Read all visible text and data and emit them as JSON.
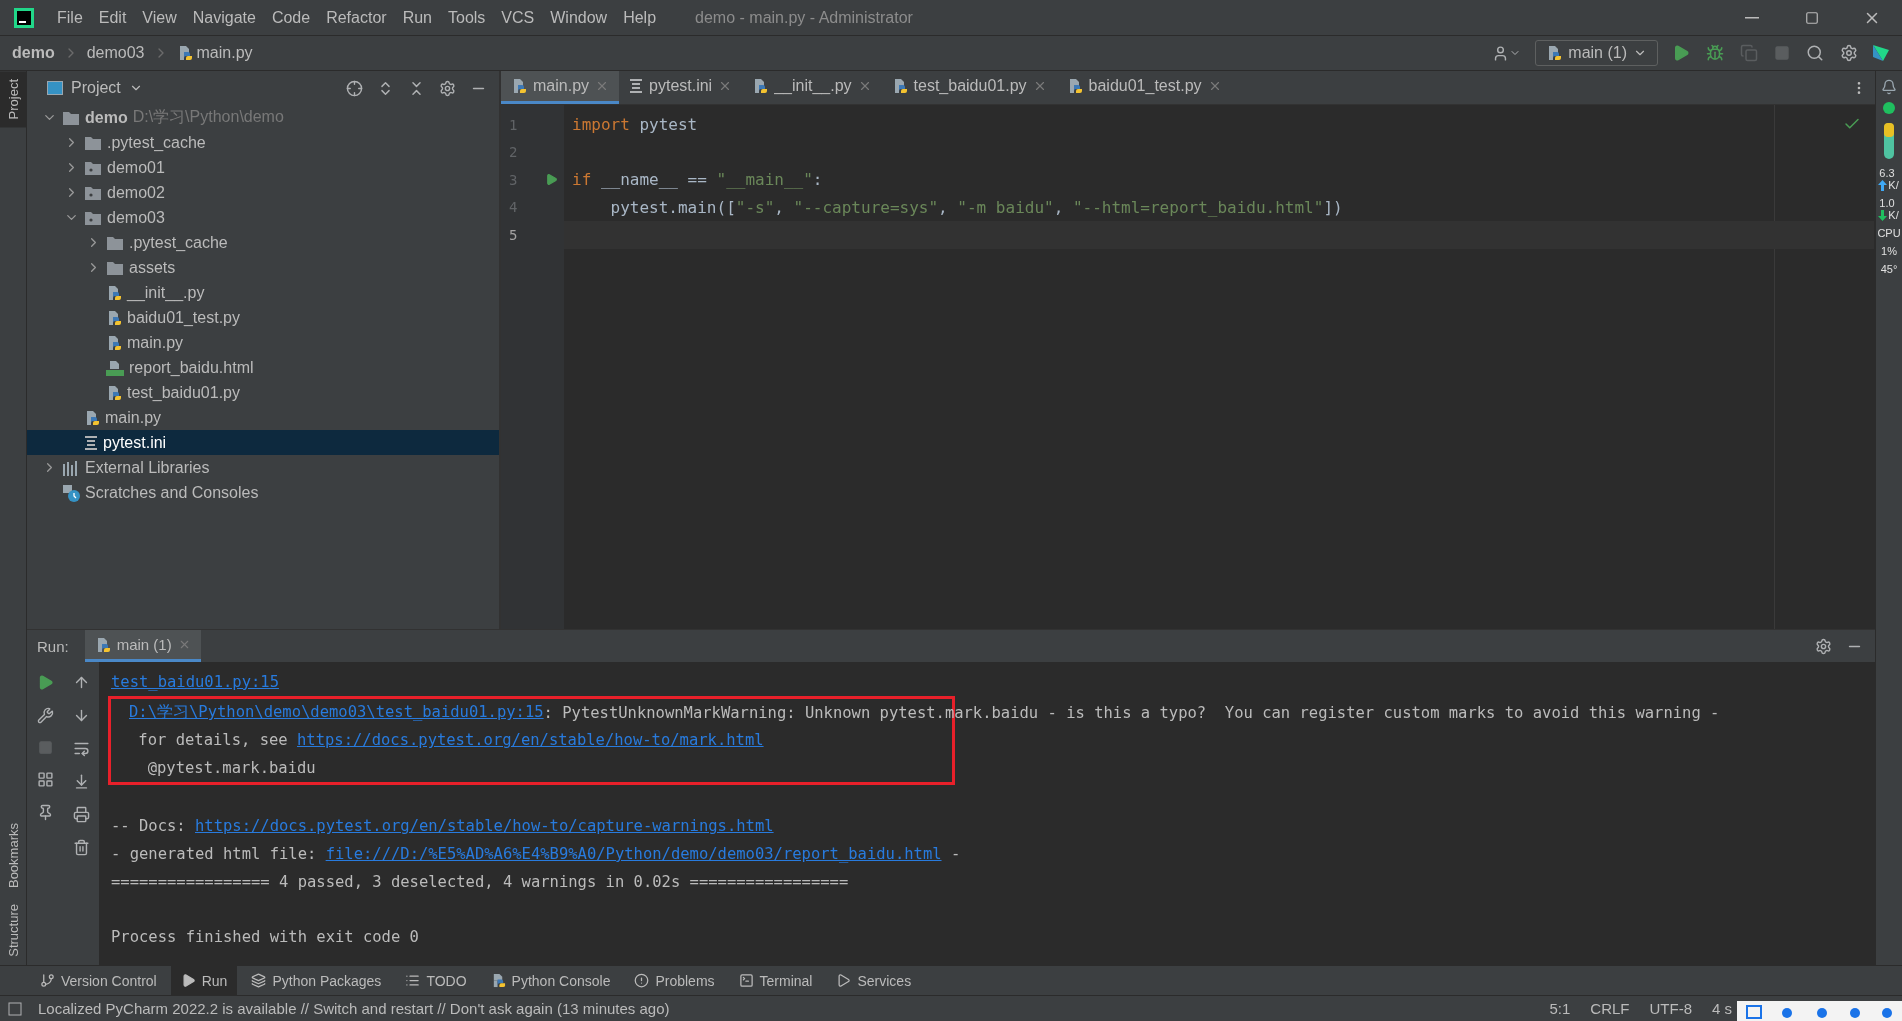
{
  "window": {
    "title": "demo - main.py - Administrator"
  },
  "menu": [
    "File",
    "Edit",
    "View",
    "Navigate",
    "Code",
    "Refactor",
    "Run",
    "Tools",
    "VCS",
    "Window",
    "Help"
  ],
  "breadcrumb": [
    {
      "label": "demo",
      "kind": "project"
    },
    {
      "label": "demo03",
      "kind": "folder"
    },
    {
      "label": "main.py",
      "kind": "python"
    }
  ],
  "toolbar": {
    "run_config": "main (1)"
  },
  "side_labels": {
    "top": [
      {
        "label": "Project",
        "selected": true
      }
    ],
    "bottom": [
      {
        "label": "Bookmarks",
        "selected": false
      },
      {
        "label": "Structure",
        "selected": false
      }
    ]
  },
  "project_panel": {
    "title": "Project",
    "tree": [
      {
        "label": "demo",
        "kind": "root",
        "hint": "D:\\学习\\Python\\demo",
        "expanded": true,
        "selected": false,
        "children": [
          {
            "label": ".pytest_cache",
            "kind": "folder",
            "expanded": false,
            "selected": false
          },
          {
            "label": "demo01",
            "kind": "module",
            "expanded": false,
            "selected": false
          },
          {
            "label": "demo02",
            "kind": "module",
            "expanded": false,
            "selected": false
          },
          {
            "label": "demo03",
            "kind": "module",
            "expanded": true,
            "selected": false,
            "children": [
              {
                "label": ".pytest_cache",
                "kind": "folder",
                "expanded": false,
                "selected": false
              },
              {
                "label": "assets",
                "kind": "folder",
                "expanded": false,
                "selected": false
              },
              {
                "label": "__init__.py",
                "kind": "python",
                "selected": false
              },
              {
                "label": "baidu01_test.py",
                "kind": "python",
                "selected": false
              },
              {
                "label": "main.py",
                "kind": "python",
                "selected": false
              },
              {
                "label": "report_baidu.html",
                "kind": "html",
                "selected": false
              },
              {
                "label": "test_baidu01.py",
                "kind": "python",
                "selected": false
              }
            ]
          },
          {
            "label": "main.py",
            "kind": "python",
            "selected": false
          },
          {
            "label": "pytest.ini",
            "kind": "ini",
            "selected": true
          }
        ]
      },
      {
        "label": "External Libraries",
        "kind": "libraries",
        "expanded": false,
        "selected": false
      },
      {
        "label": "Scratches and Consoles",
        "kind": "scratches",
        "selected": false
      }
    ]
  },
  "editor": {
    "tabs": [
      {
        "label": "main.py",
        "kind": "python",
        "selected": true
      },
      {
        "label": "pytest.ini",
        "kind": "ini",
        "selected": false
      },
      {
        "label": "__init__.py",
        "kind": "python",
        "selected": false
      },
      {
        "label": "test_baidu01.py",
        "kind": "python",
        "selected": false
      },
      {
        "label": "baidu01_test.py",
        "kind": "python",
        "selected": false
      }
    ],
    "lines": [
      {
        "number": "1",
        "run_marker": false,
        "current": false,
        "tokens": [
          {
            "text": "import",
            "kind": "keyword"
          },
          {
            "text": " pytest",
            "kind": "plain"
          }
        ]
      },
      {
        "number": "2",
        "run_marker": false,
        "current": false
      },
      {
        "number": "3",
        "run_marker": true,
        "current": false,
        "tokens": [
          {
            "text": "if",
            "kind": "keyword"
          },
          {
            "text": " __name__ == ",
            "kind": "plain"
          },
          {
            "text": "\"__main__\"",
            "kind": "string"
          },
          {
            "text": ":",
            "kind": "plain"
          }
        ]
      },
      {
        "number": "4",
        "run_marker": false,
        "current": false,
        "tokens": [
          {
            "text": "    pytest.main([",
            "kind": "plain"
          },
          {
            "text": "\"-s\"",
            "kind": "string"
          },
          {
            "text": ", ",
            "kind": "plain"
          },
          {
            "text": "\"--capture=sys\"",
            "kind": "string"
          },
          {
            "text": ", ",
            "kind": "plain"
          },
          {
            "text": "\"-m baidu\"",
            "kind": "string"
          },
          {
            "text": ", ",
            "kind": "plain"
          },
          {
            "text": "\"--html=report_baidu.html\"",
            "kind": "string"
          },
          {
            "text": "])",
            "kind": "plain"
          }
        ]
      },
      {
        "number": "5",
        "run_marker": false,
        "current": true
      }
    ]
  },
  "run_panel": {
    "label": "Run:",
    "tabs": [
      {
        "label": "main (1)",
        "selected": true
      }
    ],
    "output": [
      {
        "kind": "text",
        "highlighted": false,
        "parts": [
          {
            "text": "test_baidu01.py:15",
            "kind": "link"
          }
        ]
      },
      {
        "kind": "text",
        "highlighted": true,
        "parts": [
          {
            "text": "D:\\学习\\Python\\demo\\demo03\\test_baidu01.py:15",
            "kind": "link"
          },
          {
            "text": ": PytestUnknownMarkWarning: Unknown pytest.mark.baidu - is this a typo?  You can register custom marks to avoid this warning -",
            "kind": "plain"
          }
        ]
      },
      {
        "kind": "text",
        "highlighted": true,
        "parts": [
          {
            "text": " for details, see ",
            "kind": "plain"
          },
          {
            "text": "https://docs.pytest.org/en/stable/how-to/mark.html",
            "kind": "link"
          }
        ]
      },
      {
        "kind": "text",
        "highlighted": true,
        "parts": [
          {
            "text": "  @pytest.mark.baidu",
            "kind": "plain"
          }
        ]
      },
      {
        "kind": "blank",
        "highlighted": false
      },
      {
        "kind": "text",
        "highlighted": false,
        "parts": [
          {
            "text": "-- Docs: ",
            "kind": "plain"
          },
          {
            "text": "https://docs.pytest.org/en/stable/how-to/capture-warnings.html",
            "kind": "link"
          }
        ]
      },
      {
        "kind": "text",
        "highlighted": false,
        "parts": [
          {
            "text": "- generated html file: ",
            "kind": "plain"
          },
          {
            "text": "file:///D:/%E5%AD%A6%E4%B9%A0/Python/demo/demo03/report_baidu.html",
            "kind": "link"
          },
          {
            "text": " -",
            "kind": "plain"
          }
        ]
      },
      {
        "kind": "text",
        "highlighted": false,
        "parts": [
          {
            "text": "================= 4 passed, 3 deselected, 4 warnings in 0.02s =================",
            "kind": "plain"
          }
        ]
      },
      {
        "kind": "blank",
        "highlighted": false
      },
      {
        "kind": "text",
        "highlighted": false,
        "parts": [
          {
            "text": "Process finished with exit code 0",
            "kind": "plain"
          }
        ]
      }
    ]
  },
  "monitor": {
    "rates": [
      {
        "value": "6.3",
        "kind": "upload",
        "unit": "K/",
        "color": "#3fa9f5"
      },
      {
        "value": "1.0",
        "kind": "download",
        "unit": "K/",
        "color": "#1fbf5f"
      }
    ],
    "cpu_label": "CPU",
    "cpu_usage": "1%",
    "temperature": "45°"
  },
  "tool_tabs": [
    {
      "label": "Version Control",
      "kind": "vcs",
      "selected": false
    },
    {
      "label": "Run",
      "kind": "run",
      "selected": true
    },
    {
      "label": "Python Packages",
      "kind": "packages",
      "selected": false
    },
    {
      "label": "TODO",
      "kind": "todo",
      "selected": false
    },
    {
      "label": "Python Console",
      "kind": "console",
      "selected": false
    },
    {
      "label": "Problems",
      "kind": "problems",
      "selected": false
    },
    {
      "label": "Terminal",
      "kind": "terminal",
      "selected": false
    },
    {
      "label": "Services",
      "kind": "services",
      "selected": false
    }
  ],
  "status_bar": {
    "message": "Localized PyCharm 2022.2 is available // Switch and restart // Don't ask again (13 minutes ago)",
    "items": [
      "5:1",
      "CRLF",
      "UTF-8",
      "4 s"
    ]
  }
}
